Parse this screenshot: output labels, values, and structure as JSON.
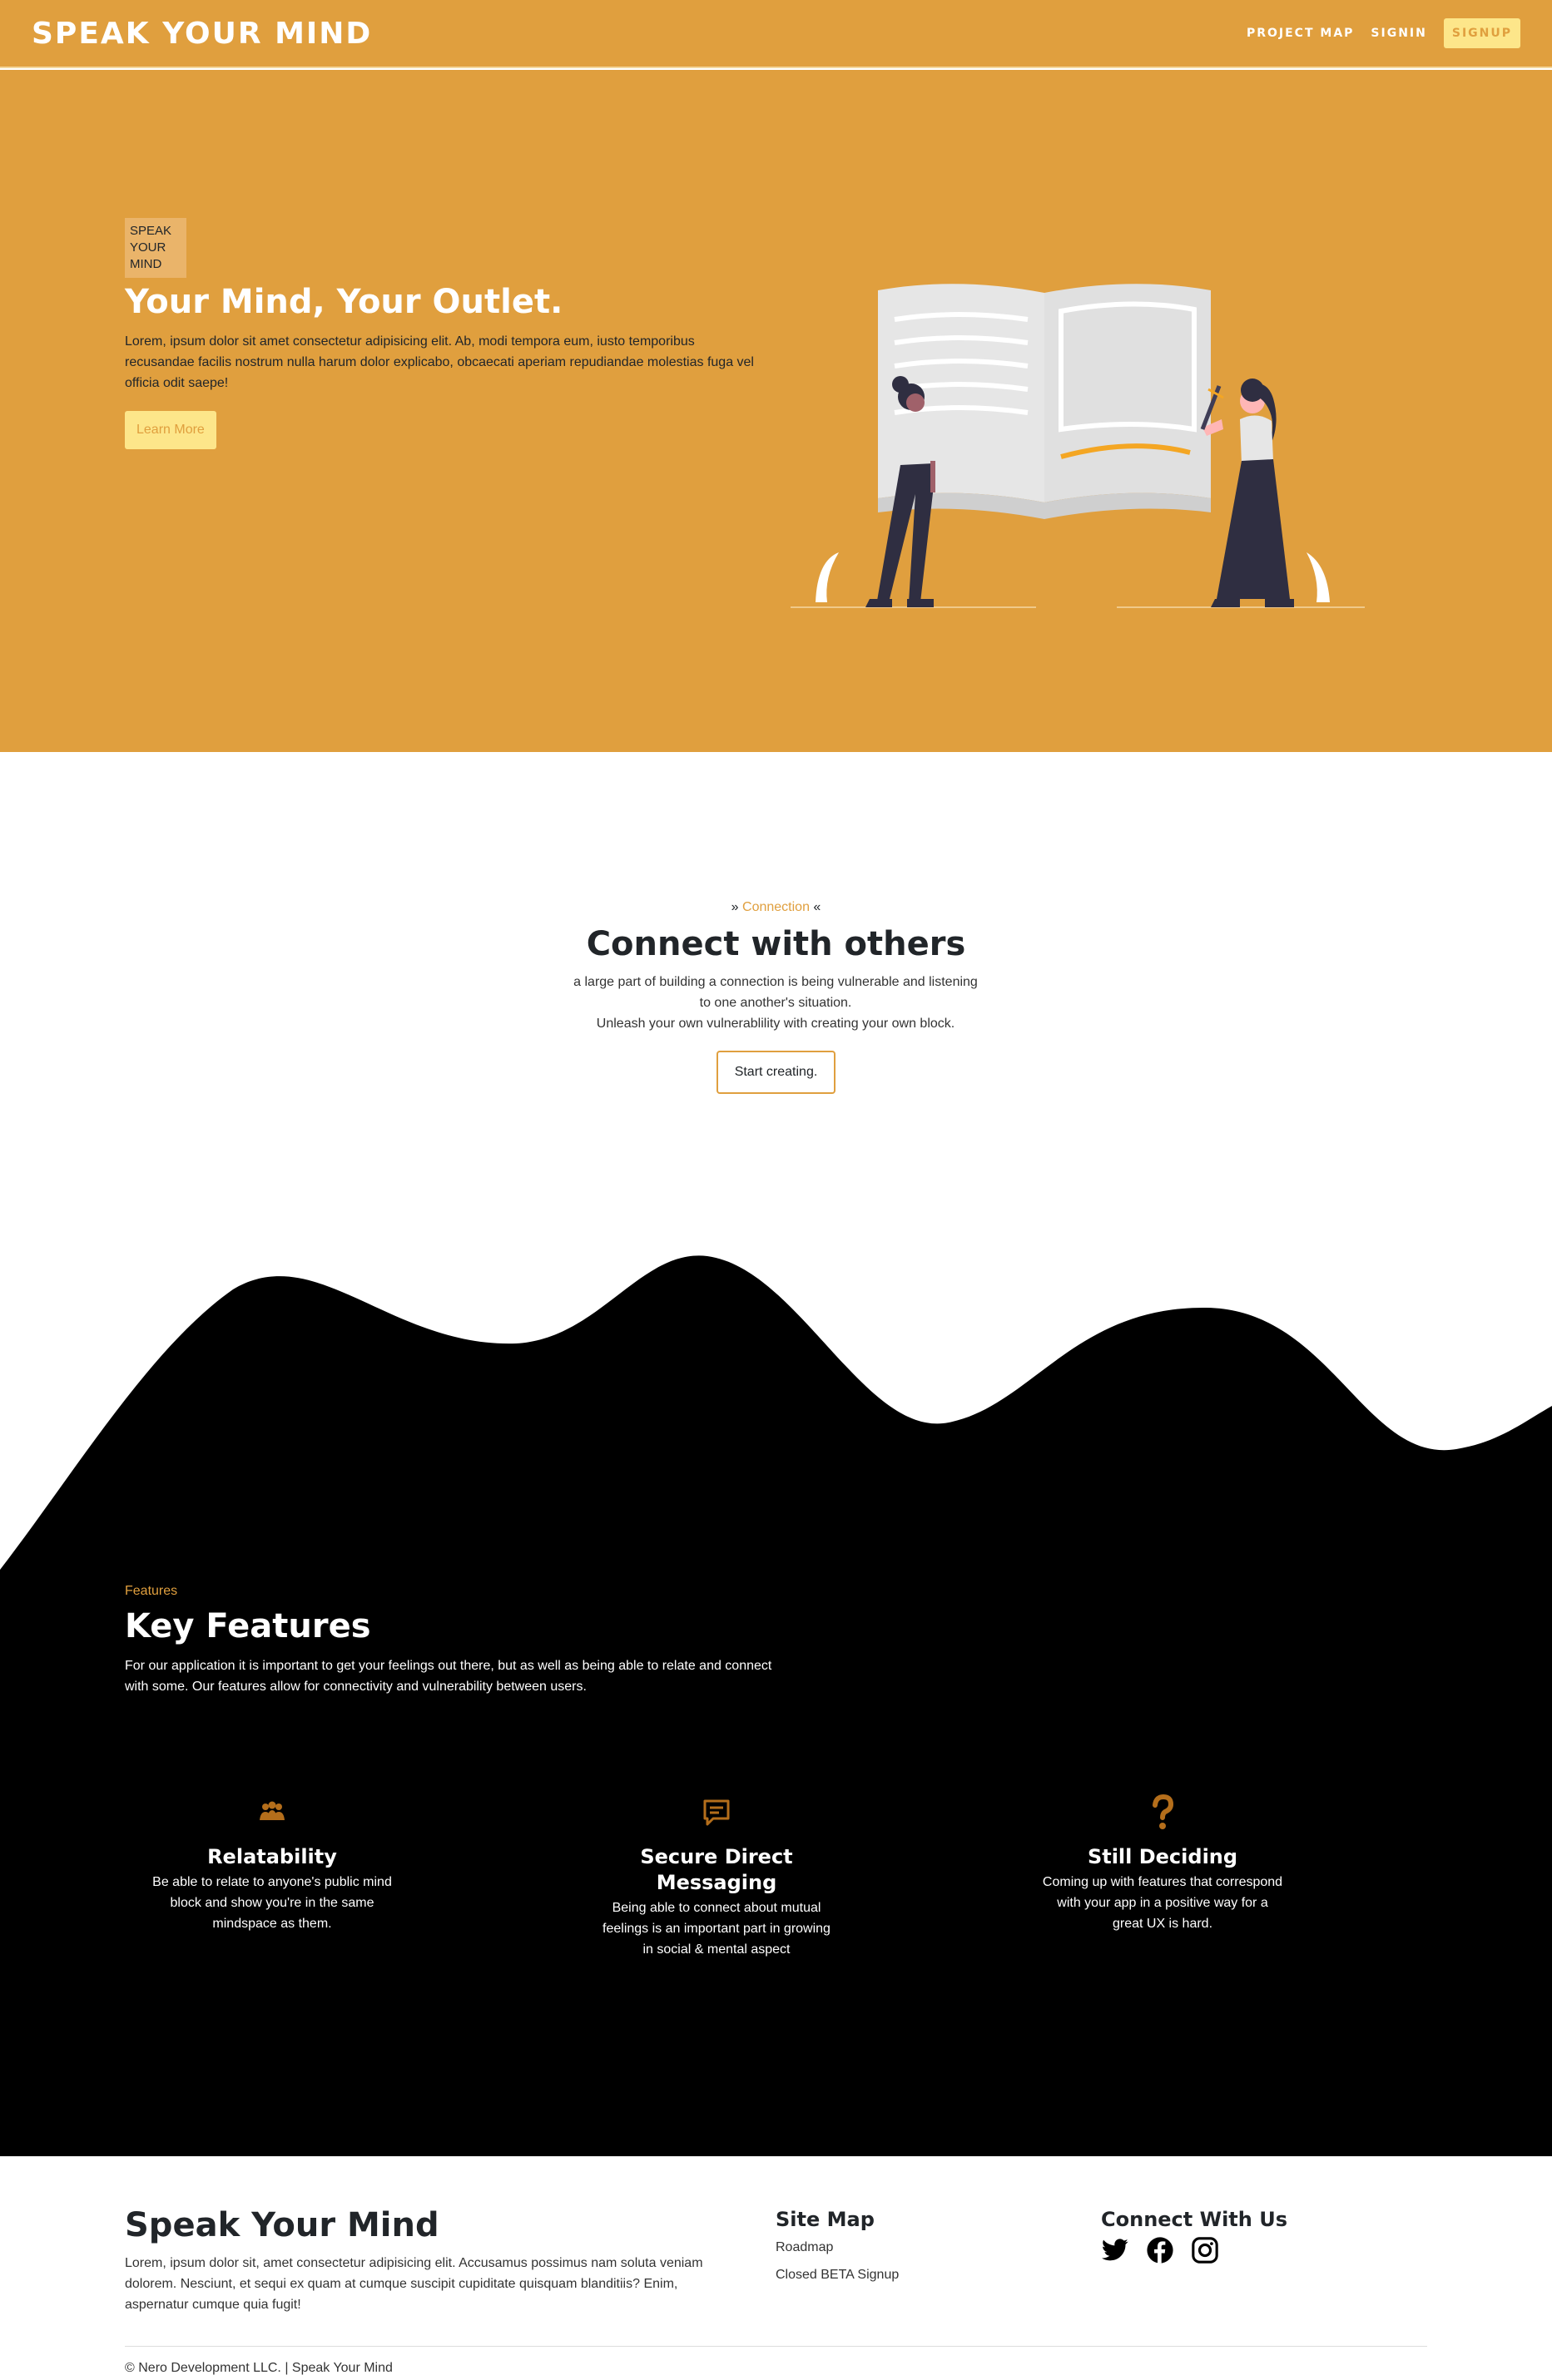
{
  "nav": {
    "brand": "SPEAK YOUR MIND",
    "links": [
      "PROJECT MAP",
      "SIGNIN"
    ],
    "signup": "SIGNUP"
  },
  "hero": {
    "badge": "SPEAK YOUR MIND",
    "title": "Your Mind, Your Outlet.",
    "text": "Lorem, ipsum dolor sit amet consectetur adipisicing elit. Ab, modi tempora eum, iusto temporibus recusandae facilis nostrum nulla harum dolor explicabo, obcaecati aperiam repudiandae molestias fuga vel officia odit saepe!",
    "button": "Learn More"
  },
  "connection": {
    "eyebrow_left": "» ",
    "eyebrow_accent": "Connection",
    "eyebrow_right": " «",
    "title": "Connect with others",
    "text": "a large part of building a connection is being vulnerable and listening to one another's situation.",
    "text2": "Unleash your own vulnerablility with creating your own block.",
    "button": "Start creating."
  },
  "features": {
    "eyebrow": "Features",
    "title": "Key Features",
    "text": "For our application it is important to get your feelings out there, but as well as being able to relate and connect with some. Our features allow for connectivity and vulnerability between users.",
    "items": [
      {
        "icon": "people-icon",
        "name": "Relatability",
        "desc": "Be able to relate to anyone's public mind block and show you're in the same mindspace as them."
      },
      {
        "icon": "message-icon",
        "name": "Secure Direct Messaging",
        "desc": "Being able to connect about mutual feelings is an important part in growing in social & mental aspect"
      },
      {
        "icon": "question-icon",
        "name": "Still Deciding",
        "desc": "Coming up with features that correspond with your app in a positive way for a great UX is hard."
      }
    ]
  },
  "footer": {
    "title": "Speak Your Mind",
    "text": "Lorem, ipsum dolor sit, amet consectetur adipisicing elit. Accusamus possimus nam soluta veniam dolorem. Nesciunt, et sequi ex quam at cumque suscipit cupiditate quisquam blanditiis? Enim, aspernatur cumque quia fugit!",
    "sitemap_title": "Site Map",
    "sitemap_links": [
      "Roadmap",
      "Closed BETA Signup"
    ],
    "connect_title": "Connect With Us",
    "social": [
      "twitter-icon",
      "facebook-icon",
      "instagram-icon"
    ],
    "copyright": "© Nero Development LLC. | Speak Your Mind"
  },
  "colors": {
    "accent": "#e09f3e",
    "button_light": "#fde68a",
    "dark": "#000000",
    "icon": "#b46e1b"
  }
}
